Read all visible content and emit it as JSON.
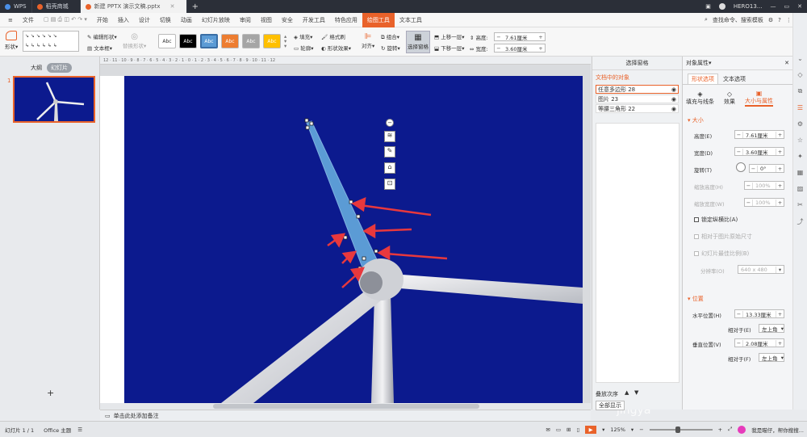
{
  "titlebar": {
    "app_tab": "WPS",
    "tab1": "稻壳商城",
    "tab2": "新建 PPTX 演示文稿.pptx",
    "user": "HERO13..."
  },
  "menubar": {
    "file": "文件",
    "items": [
      "开始",
      "插入",
      "设计",
      "切换",
      "动画",
      "幻灯片放映",
      "审阅",
      "视图",
      "安全",
      "开发工具",
      "特色应用",
      "绘图工具",
      "文本工具"
    ],
    "search": "查找命令、搜索模板"
  },
  "ribbon": {
    "shape": "形状",
    "edit_shape": "编辑形状",
    "textbox": "文本框",
    "replace_shape": "替换形状",
    "style_text": "Abc",
    "fill": "填充",
    "format_brush": "格式刷",
    "outline": "轮廓",
    "shape_effect": "形状效果",
    "align": "对齐",
    "group": "组合",
    "rotate": "旋转",
    "select_pane": "选择窗格",
    "bring_forward": "上移一层",
    "send_backward": "下移一层",
    "height_label": "高度:",
    "height_value": "7.61厘米",
    "width_label": "宽度:",
    "width_value": "3.60厘米",
    "style_colors": [
      "#ffffff",
      "#000000",
      "#5b9bd5",
      "#ed7d31",
      "#a5a5a5",
      "#ffc000"
    ]
  },
  "leftpane": {
    "outline_tab": "大纲",
    "slides_tab": "幻灯片",
    "slide_number": "1",
    "add": "+"
  },
  "canvas": {
    "ruler": "12 · 11 · 10 · 9 · 8 · 7 · 6 · 5 · 4 · 3 · 2 · 1 · 0 · 1 · 2 · 3 · 4 · 5 · 6 · 7 · 8 · 9 · 10 · 11 · 12",
    "notes": "单击此处添加备注",
    "watermark": "jingya"
  },
  "selection_pane": {
    "title": "选择窗格",
    "section": "文档中的对象",
    "objects": [
      "任意多边形 28",
      "图片 23",
      "等腰三角形 22"
    ],
    "stack_order": "叠放次序",
    "show_all": "全部显示"
  },
  "property_pane": {
    "title": "对象属性",
    "tab_shape": "形状选项",
    "tab_text": "文本选项",
    "sub_fill": "填充与线条",
    "sub_effect": "效果",
    "sub_size": "大小与属性",
    "size_section": "大小",
    "height_label": "高度(E)",
    "height_value": "7.61厘米",
    "width_label": "宽度(D)",
    "width_value": "3.60厘米",
    "rotate_label": "旋转(T)",
    "rotate_value": "0°",
    "scale_h_label": "缩放高度(H)",
    "scale_h_value": "100%",
    "scale_w_label": "缩放宽度(W)",
    "scale_w_value": "100%",
    "lock_ratio": "锁定纵横比(A)",
    "relative_pic": "相对于图片原始尺寸",
    "best_fit": "幻灯片最佳比例(B)",
    "resolution_label": "分辨率(O)",
    "resolution_value": "640 x 480",
    "position_section": "位置",
    "hpos_label": "水平位置(H)",
    "hpos_value": "13.33厘米",
    "relative_label": "相对于(E)",
    "relative_value": "左上角",
    "vpos_label": "垂直位置(V)",
    "vpos_value": "2.08厘米",
    "relative2_label": "相对于(F)",
    "relative2_value": "左上角"
  },
  "statusbar": {
    "slide_info": "幻灯片 1 / 1",
    "theme": "Office 主题",
    "zoom": "125%",
    "assistant": "我是瞄仔，帮你搜搜..."
  }
}
